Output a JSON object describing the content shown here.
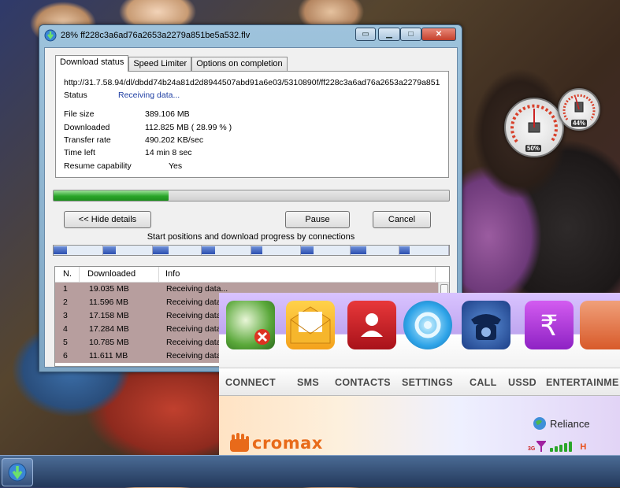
{
  "idm": {
    "title": "28% ff228c3a6ad76a2653a2279a851be5a532.flv",
    "tabs": [
      "Download status",
      "Speed Limiter",
      "Options on completion"
    ],
    "url": "http://31.7.58.94/dl/dbdd74b24a81d2d8944507abd91a6e03/5310890f/ff228c3a6ad76a2653a2279a851be5a532.flv",
    "status_label": "Status",
    "status_value": "Receiving data...",
    "fields": [
      {
        "label": "File size",
        "value": "389.106  MB"
      },
      {
        "label": "Downloaded",
        "value": "112.825  MB  ( 28.99 % )"
      },
      {
        "label": "Transfer rate",
        "value": "490.202  KB/sec"
      },
      {
        "label": "Time left",
        "value": "14 min 8 sec"
      },
      {
        "label": "Resume capability",
        "value": "Yes"
      }
    ],
    "progress_fraction": 0.2899,
    "buttons": {
      "hide_details": "<< Hide details",
      "pause": "Pause",
      "cancel": "Cancel"
    },
    "connections_caption": "Start positions and download progress by connections",
    "connection_progress": [
      0.27,
      0.27,
      0.33,
      0.27,
      0.23,
      0.27,
      0.33,
      0.2
    ],
    "table": {
      "headers": [
        "N.",
        "Downloaded",
        "Info"
      ],
      "rows": [
        {
          "n": "1",
          "downloaded": "19.035  MB",
          "info": "Receiving data..."
        },
        {
          "n": "2",
          "downloaded": "11.596  MB",
          "info": "Receiving data"
        },
        {
          "n": "3",
          "downloaded": "17.158  MB",
          "info": "Receiving data"
        },
        {
          "n": "4",
          "downloaded": "17.284  MB",
          "info": "Receiving data"
        },
        {
          "n": "5",
          "downloaded": "10.785  MB",
          "info": "Receiving data"
        },
        {
          "n": "6",
          "downloaded": "11.611  MB",
          "info": "Receiving data"
        }
      ]
    }
  },
  "gadget": {
    "cpu_label": "50%",
    "memory_label": "44%",
    "cpu_fraction": 0.5,
    "memory_fraction": 0.44
  },
  "micromax": {
    "icons": [
      "globe-disconnect-icon",
      "envelope-icon",
      "contacts-book-icon",
      "settings-gear-icon",
      "telephone-icon",
      "rupee-icon",
      "logo-hand-icon"
    ],
    "nav": [
      "CONNECT",
      "SMS",
      "CONTACTS",
      "SETTINGS",
      "CALL",
      "USSD",
      "ENTERTAINME"
    ],
    "logo_text": "cromax",
    "operator": "Reliance",
    "network_type": "3G",
    "signal_bars": 5,
    "roaming_indicator": "H"
  },
  "taskbar": {
    "start_icon": "idm-taskbar-icon"
  },
  "colors": {
    "progress_green": "#2aa62a",
    "status_blue": "#1f3fa3",
    "micromax_orange": "#e86a1a",
    "row_highlight": "#b79e9e"
  }
}
